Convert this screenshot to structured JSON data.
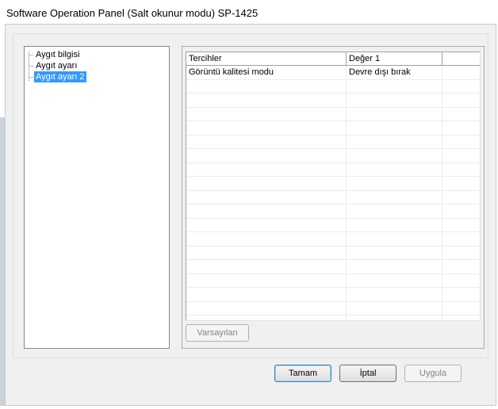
{
  "window": {
    "title": "Software Operation Panel (Salt okunur modu) SP-1425"
  },
  "tree": {
    "items": [
      {
        "label": "Aygıt bilgisi",
        "selected": false
      },
      {
        "label": "Aygıt ayarı",
        "selected": false
      },
      {
        "label": "Aygıt ayarı 2",
        "selected": true
      }
    ]
  },
  "grid": {
    "columns": [
      "Tercihler",
      "Değer 1",
      ""
    ],
    "rows": [
      [
        "Görüntü kalitesi modu",
        "Devre dışı bırak",
        ""
      ]
    ],
    "empty_rows": 18
  },
  "buttons": {
    "default_label": "Varsayılan",
    "ok_label": "Tamam",
    "cancel_label": "İptal",
    "apply_label": "Uygula"
  },
  "colors": {
    "selection": "#3399ff",
    "dialog_bg": "#f0f0f0"
  }
}
